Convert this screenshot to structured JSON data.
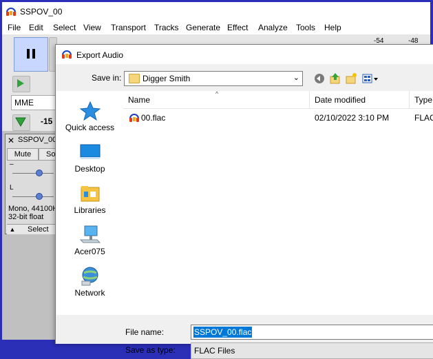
{
  "app": {
    "title": "SSPOV_00",
    "menu": [
      "File",
      "Edit",
      "Select",
      "View",
      "Transport",
      "Tracks",
      "Generate",
      "Effect",
      "Analyze",
      "Tools",
      "Help"
    ],
    "host": "MME",
    "meter_label": "-15",
    "ruler_labels": [
      "-54",
      "-48"
    ]
  },
  "track": {
    "name": "SSPOV_00",
    "mute_label": "Mute",
    "solo_label": "So",
    "gain_mark": "–",
    "pan_mark": "L",
    "info_line1": "Mono, 44100H",
    "info_line2": "32-bit float",
    "select_label": "Select"
  },
  "dialog": {
    "title": "Export Audio",
    "save_in_label": "Save in:",
    "save_in_value": "Digger Smith",
    "places": [
      {
        "label": "Quick access",
        "icon": "star-icon"
      },
      {
        "label": "Desktop",
        "icon": "desktop-icon"
      },
      {
        "label": "Libraries",
        "icon": "libraries-icon"
      },
      {
        "label": "Acer075",
        "icon": "computer-icon"
      },
      {
        "label": "Network",
        "icon": "network-icon"
      }
    ],
    "columns": {
      "name": "Name",
      "date": "Date modified",
      "type": "Type"
    },
    "files": [
      {
        "name": "00.flac",
        "date": "02/10/2022 3:10 PM",
        "type": "FLAC"
      }
    ],
    "file_name_label": "File name:",
    "file_name_value": "SSPOV_00.flac",
    "save_type_label": "Save as type:",
    "save_type_value": "FLAC Files"
  },
  "colors": {
    "accent": "#0078d7",
    "frame": "#2b2fb8"
  }
}
